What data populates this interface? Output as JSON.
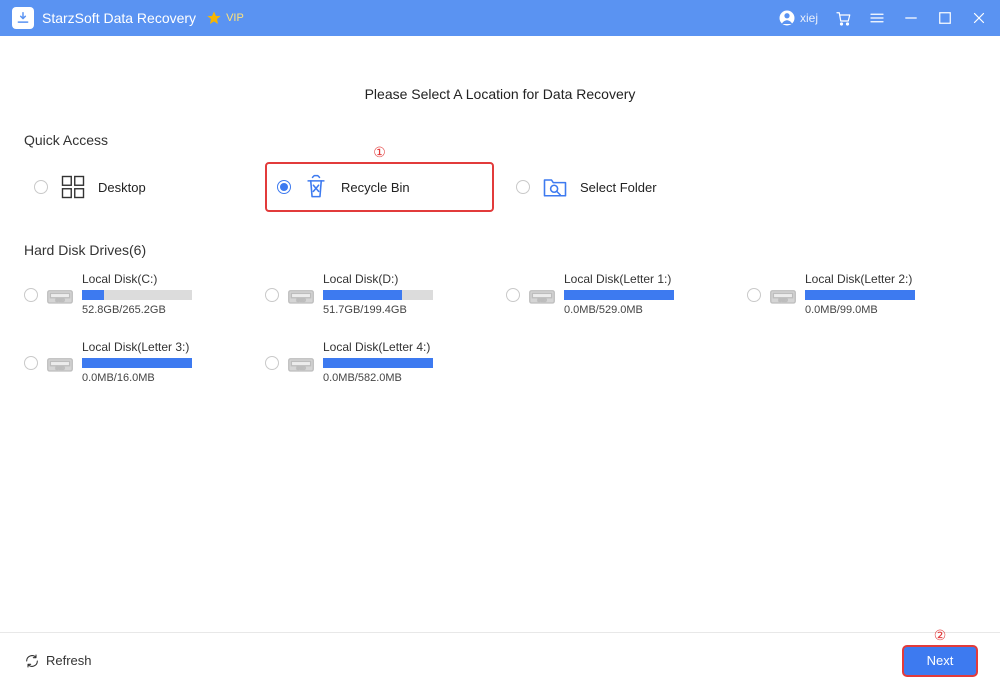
{
  "titlebar": {
    "title": "StarzSoft Data Recovery",
    "vip": "VIP",
    "user": "xiej"
  },
  "page": {
    "title": "Please Select A Location for Data Recovery"
  },
  "quick_access": {
    "heading": "Quick Access",
    "items": [
      {
        "label": "Desktop",
        "selected": false
      },
      {
        "label": "Recycle Bin",
        "selected": true,
        "highlight": true,
        "annot": "①"
      },
      {
        "label": "Select Folder",
        "selected": false
      }
    ]
  },
  "drives_heading": "Hard Disk Drives(6)",
  "drives": [
    {
      "name": "Local Disk(C:)",
      "size": "52.8GB/265.2GB",
      "pct": 20
    },
    {
      "name": "Local Disk(D:)",
      "size": "51.7GB/199.4GB",
      "pct": 72
    },
    {
      "name": "Local Disk(Letter 1:)",
      "size": "0.0MB/529.0MB",
      "pct": 100
    },
    {
      "name": "Local Disk(Letter 2:)",
      "size": "0.0MB/99.0MB",
      "pct": 100
    },
    {
      "name": "Local Disk(Letter 3:)",
      "size": "0.0MB/16.0MB",
      "pct": 100
    },
    {
      "name": "Local Disk(Letter 4:)",
      "size": "0.0MB/582.0MB",
      "pct": 100
    }
  ],
  "footer": {
    "refresh": "Refresh",
    "next": "Next",
    "next_annot": "②"
  },
  "colors": {
    "accent": "#3d7af0",
    "highlight": "#e23b3b"
  }
}
